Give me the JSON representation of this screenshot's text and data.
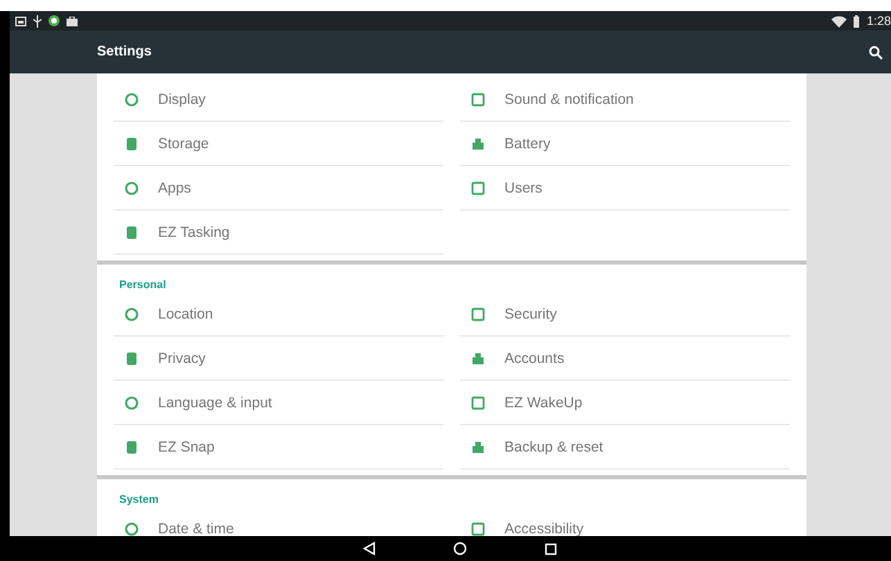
{
  "status_bar": {
    "time": "1:28"
  },
  "toolbar": {
    "title": "Settings"
  },
  "sections": [
    {
      "items": [
        {
          "label": "Display"
        },
        {
          "label": "Sound & notification"
        },
        {
          "label": "Storage"
        },
        {
          "label": "Battery"
        },
        {
          "label": "Apps"
        },
        {
          "label": "Users"
        },
        {
          "label": "EZ Tasking"
        }
      ]
    },
    {
      "header": "Personal",
      "items": [
        {
          "label": "Location"
        },
        {
          "label": "Security"
        },
        {
          "label": "Privacy"
        },
        {
          "label": "Accounts"
        },
        {
          "label": "Language & input"
        },
        {
          "label": "EZ WakeUp"
        },
        {
          "label": "EZ Snap"
        },
        {
          "label": "Backup & reset"
        }
      ]
    },
    {
      "header": "System",
      "items": [
        {
          "label": "Date & time"
        },
        {
          "label": "Accessibility"
        }
      ]
    }
  ]
}
